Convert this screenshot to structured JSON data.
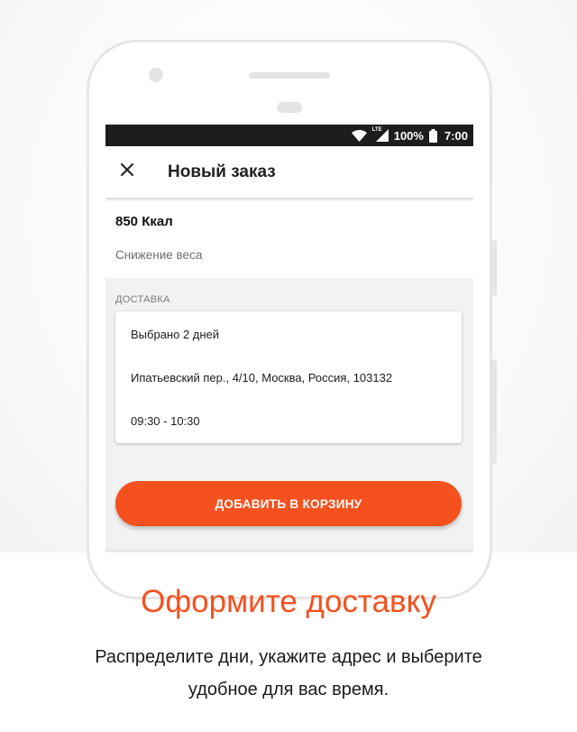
{
  "status_bar": {
    "battery_percent": "100%",
    "time": "7:00",
    "network": "LTE",
    "icons": [
      "wifi-icon",
      "signal-icon",
      "battery-icon"
    ]
  },
  "app_bar": {
    "title": "Новый заказ",
    "close_icon": "close-icon"
  },
  "plan": {
    "calories": "850 Ккал",
    "goal": "Снижение веса"
  },
  "delivery": {
    "section_label": "ДОСТАВКА",
    "days_selected": "Выбрано 2 дней",
    "address": "Ипатьевский пер., 4/10, Москва, Россия, 103132",
    "time_window": "09:30 - 10:30"
  },
  "actions": {
    "add_to_cart": "ДОБАВИТЬ В КОРЗИНУ"
  },
  "promo": {
    "heading": "Оформите доставку",
    "line1": "Распределите дни, укажите адрес и выберите",
    "line2": "удобное для вас время."
  },
  "colors": {
    "accent": "#f4511e",
    "status_bar": "#1d1d1d",
    "screen_background": "#f2f2f2"
  }
}
